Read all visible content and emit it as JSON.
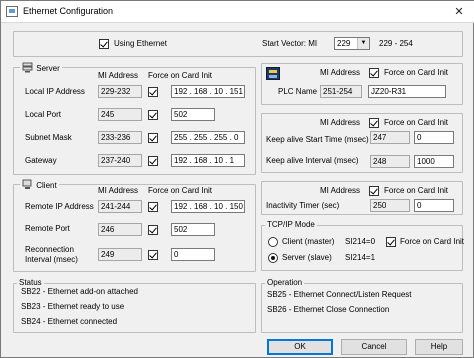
{
  "window": {
    "title": "Ethernet Configuration",
    "close_glyph": "✕"
  },
  "top": {
    "using_ethernet_label": "Using Ethernet",
    "using_ethernet_checked": true,
    "start_vector_label": "Start Vector: MI",
    "start_vector_value": "229",
    "start_vector_range": "229 - 254"
  },
  "server": {
    "title": "Server",
    "col_mi": "MI Address",
    "col_force": "Force on Card Init",
    "rows": [
      {
        "label": "Local IP Address",
        "mi": "229-232",
        "force": true,
        "value": "192 . 168 . 10 . 151"
      },
      {
        "label": "Local Port",
        "mi": "245",
        "force": true,
        "value": "502"
      },
      {
        "label": "Subnet Mask",
        "mi": "233-236",
        "force": true,
        "value": "255 . 255 . 255 . 0"
      },
      {
        "label": "Gateway",
        "mi": "237-240",
        "force": true,
        "value": "192 . 168 . 10 . 1"
      }
    ]
  },
  "client": {
    "title": "Client",
    "col_mi": "MI Address",
    "col_force": "Force on Card Init",
    "rows": [
      {
        "label": "Remote IP Address",
        "mi": "241-244",
        "force": true,
        "value": "192 . 168 . 10 . 150"
      },
      {
        "label": "Remote Port",
        "mi": "246",
        "force": true,
        "value": "502"
      },
      {
        "label": "Reconnection",
        "label2": "Interval (msec)",
        "mi": "249",
        "force": true,
        "value": "0"
      }
    ]
  },
  "plc": {
    "col_mi": "MI Address",
    "force_label": "Force on Card Init",
    "force": true,
    "name_label": "PLC Name",
    "mi": "251-254",
    "value": "JZ20-R31"
  },
  "keepalive": {
    "col_mi": "MI Address",
    "force_label": "Force on Card Init",
    "force": true,
    "start_label": "Keep alive Start Time (msec)",
    "start_mi": "247",
    "start_value": "0",
    "interval_label": "Keep alive Interval (msec)",
    "interval_mi": "248",
    "interval_value": "1000"
  },
  "inactivity": {
    "col_mi": "MI Address",
    "force_label": "Force on Card Init",
    "force": true,
    "label": "Inactivity Timer (sec)",
    "mi": "250",
    "value": "0"
  },
  "tcpip": {
    "title": "TCP/IP Mode",
    "client_label": "Client (master)",
    "client_sb": "SI214=0",
    "server_label": "Server (slave)",
    "server_sb": "SI214=1",
    "selected": "server",
    "force_label": "Force on Card Init",
    "force": true
  },
  "status": {
    "title": "Status",
    "lines": [
      "SB22 - Ethernet add-on attached",
      "SB23 - Ethernet ready to use",
      "SB24 - Ethernet connected"
    ]
  },
  "operation": {
    "title": "Operation",
    "lines": [
      "SB25 - Ethernet Connect/Listen Request",
      "SB26 - Ethernet Close Connection"
    ]
  },
  "buttons": {
    "ok": "OK",
    "cancel": "Cancel",
    "help": "Help"
  }
}
